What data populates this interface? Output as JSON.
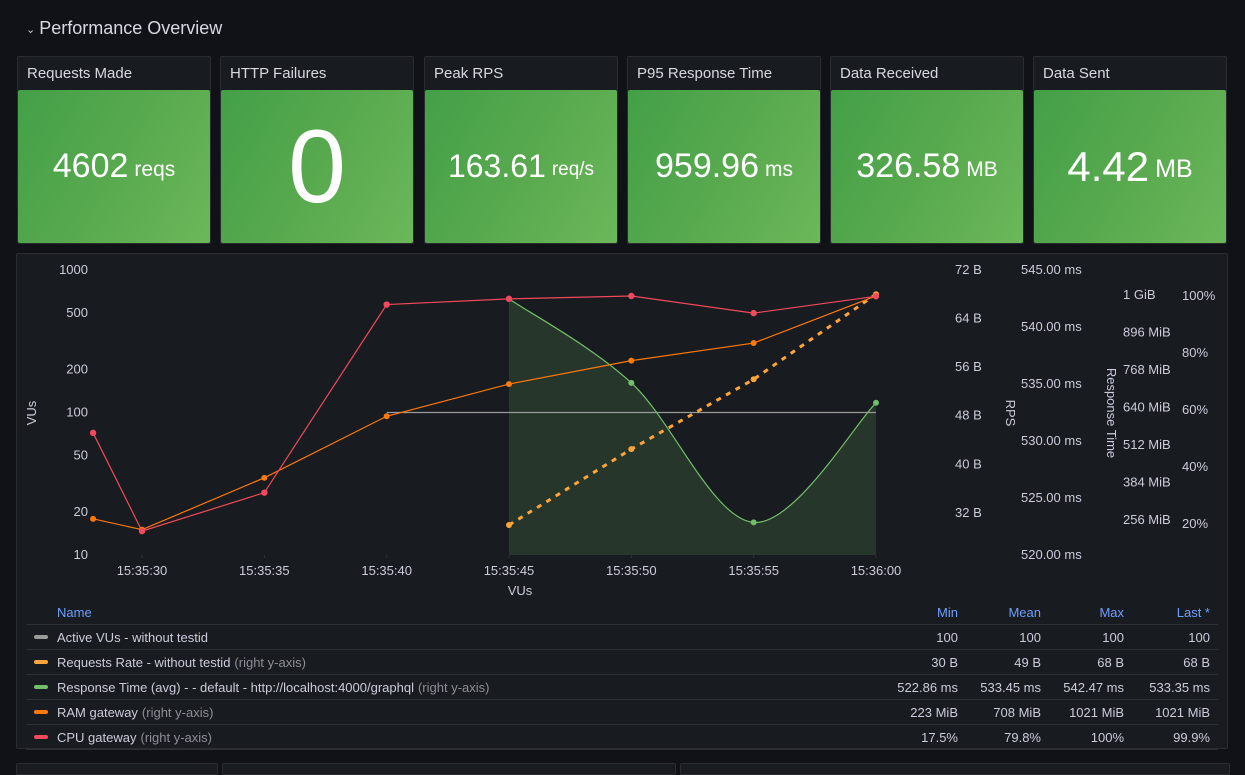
{
  "row": {
    "title": "Performance Overview",
    "chevron_icon": "chevron-down-icon"
  },
  "stats": [
    {
      "title": "Requests Made",
      "value": "4602",
      "unit": "reqs",
      "color": "#56a64b"
    },
    {
      "title": "HTTP Failures",
      "value": "0",
      "unit": "",
      "color": "#56a64b"
    },
    {
      "title": "Peak RPS",
      "value": "163.61",
      "unit": "req/s",
      "color": "#56a64b"
    },
    {
      "title": "P95 Response Time",
      "value": "959.96",
      "unit": "ms",
      "color": "#56a64b"
    },
    {
      "title": "Data Received",
      "value": "326.58",
      "unit": "MB",
      "color": "#56a64b"
    },
    {
      "title": "Data Sent",
      "value": "4.42",
      "unit": "MB",
      "color": "#56a64b"
    }
  ],
  "chart_data": {
    "type": "line",
    "x": [
      "15:35:28",
      "15:35:30",
      "15:35:35",
      "15:35:40",
      "15:35:45",
      "15:35:50",
      "15:35:55",
      "15:36:00"
    ],
    "x_ticks": [
      "15:35:30",
      "15:35:35",
      "15:35:40",
      "15:35:45",
      "15:35:50",
      "15:35:55",
      "15:36:00"
    ],
    "xlabel": "VUs",
    "axes": {
      "vus": {
        "label": "VUs",
        "scale": "log",
        "range": [
          10,
          1000
        ],
        "ticks": [
          "1000",
          "500",
          "200",
          "100",
          "50",
          "20",
          "10"
        ],
        "side": "left"
      },
      "rps": {
        "label": "RPS",
        "range": [
          30,
          72
        ],
        "ticks": [
          "72 B",
          "64 B",
          "56 B",
          "48 B",
          "40 B",
          "32 B"
        ],
        "side": "right"
      },
      "response_time": {
        "label": "Response Time",
        "range": [
          520,
          545
        ],
        "ticks": [
          "545.00 ms",
          "540.00 ms",
          "535.00 ms",
          "530.00 ms",
          "525.00 ms",
          "520.00 ms"
        ],
        "side": "right"
      },
      "ram": {
        "label": "",
        "range": [
          192,
          1090
        ],
        "ticks": [
          "1 GiB",
          "896 MiB",
          "768 MiB",
          "640 MiB",
          "512 MiB",
          "384 MiB",
          "256 MiB"
        ],
        "side": "right"
      },
      "cpu": {
        "label": "",
        "range": [
          15,
          107
        ],
        "ticks": [
          "100%",
          "80%",
          "60%",
          "40%",
          "20%"
        ],
        "side": "right"
      }
    },
    "series": [
      {
        "name": "Active VUs - without testid",
        "axis": "vus",
        "color": "#9a9a9a",
        "style": "solid",
        "values": [
          null,
          null,
          null,
          100,
          100,
          100,
          100,
          100
        ]
      },
      {
        "name": "Requests Rate - without testid",
        "axis": "rps",
        "color": "#ffa43a",
        "style": "dashed",
        "values": [
          null,
          null,
          null,
          null,
          30,
          42.5,
          54,
          68
        ]
      },
      {
        "name": "Response Time (avg) - - default - http://localhost:4000/graphql",
        "axis": "response_time",
        "color": "#73bf69",
        "style": "smooth-fill",
        "values": [
          null,
          null,
          null,
          null,
          542.47,
          535.1,
          522.86,
          533.35
        ]
      },
      {
        "name": "RAM gateway",
        "axis": "ram",
        "color": "#ff780a",
        "style": "solid",
        "values": [
          260,
          223,
          400,
          610,
          720,
          800,
          860,
          1021
        ]
      },
      {
        "name": "CPU gateway",
        "axis": "cpu",
        "color": "#f2495c",
        "style": "solid",
        "values": [
          52,
          17.5,
          31,
          97,
          99,
          100,
          94,
          99.9
        ]
      }
    ],
    "legend": "bottom-table"
  },
  "legend": {
    "headers": {
      "name": "Name",
      "min": "Min",
      "mean": "Mean",
      "max": "Max",
      "last": "Last *"
    },
    "rows": [
      {
        "name": "Active VUs - without testid",
        "hint": "",
        "color": "#9a9a9a",
        "min": "100",
        "mean": "100",
        "max": "100",
        "last": "100"
      },
      {
        "name": "Requests Rate - without testid",
        "hint": "(right y-axis)",
        "color": "#ffa43a",
        "min": "30 B",
        "mean": "49 B",
        "max": "68 B",
        "last": "68 B"
      },
      {
        "name": "Response Time (avg) - - default - http://localhost:4000/graphql",
        "hint": "(right y-axis)",
        "color": "#73bf69",
        "min": "522.86 ms",
        "mean": "533.45 ms",
        "max": "542.47 ms",
        "last": "533.35 ms"
      },
      {
        "name": "RAM gateway",
        "hint": "(right y-axis)",
        "color": "#ff780a",
        "min": "223 MiB",
        "mean": "708 MiB",
        "max": "1021 MiB",
        "last": "1021 MiB"
      },
      {
        "name": "CPU gateway",
        "hint": "(right y-axis)",
        "color": "#f2495c",
        "min": "17.5%",
        "mean": "79.8%",
        "max": "100%",
        "last": "99.9%"
      }
    ]
  }
}
